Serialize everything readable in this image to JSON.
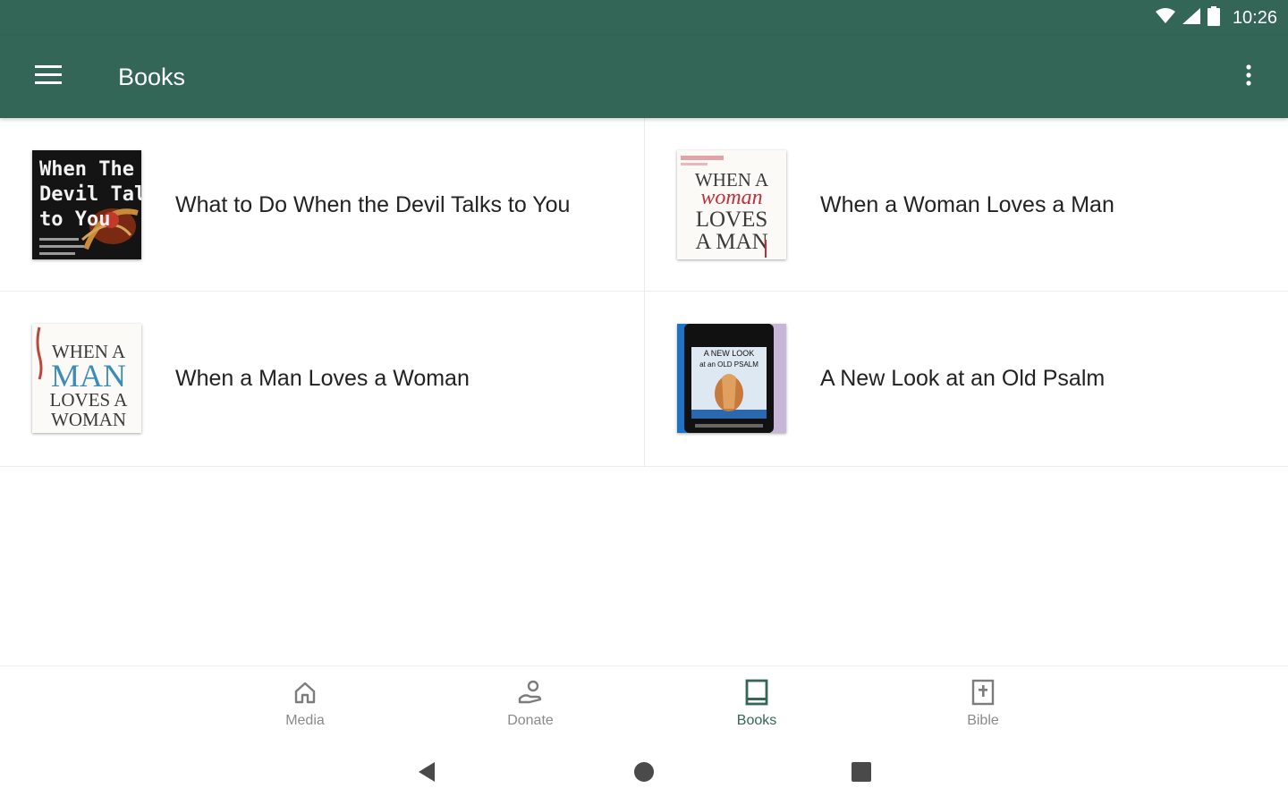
{
  "status_bar": {
    "time": "10:26"
  },
  "app_bar": {
    "title": "Books",
    "menu_icon": "menu-icon",
    "overflow_icon": "more-vert-icon",
    "background_color": "#336656"
  },
  "books": [
    {
      "title": "What to Do When the Devil Talks to You",
      "cover_text": [
        "When The",
        "Devil Talks",
        "to You"
      ]
    },
    {
      "title": "When a Woman Loves a Man",
      "cover_text": [
        "WHEN A",
        "woman",
        "LOVES",
        "A MAN"
      ]
    },
    {
      "title": "When a Man Loves a Woman",
      "cover_text": [
        "WHEN A",
        "MAN",
        "LOVES A",
        "WOMAN"
      ]
    },
    {
      "title": "A New Look at an Old Psalm",
      "cover_text": [
        "A NEW LOOK",
        "at an OLD PSALM"
      ]
    }
  ],
  "bottom_nav": {
    "items": [
      {
        "label": "Media",
        "icon": "home-icon",
        "active": false
      },
      {
        "label": "Donate",
        "icon": "donate-hand-icon",
        "active": false
      },
      {
        "label": "Books",
        "icon": "book-icon",
        "active": true
      },
      {
        "label": "Bible",
        "icon": "bible-icon",
        "active": false
      }
    ],
    "active_color": "#336656",
    "inactive_color": "#8a8a8a"
  },
  "system_nav": {
    "back_icon": "back-triangle-icon",
    "home_icon": "home-circle-icon",
    "recents_icon": "recents-square-icon"
  }
}
